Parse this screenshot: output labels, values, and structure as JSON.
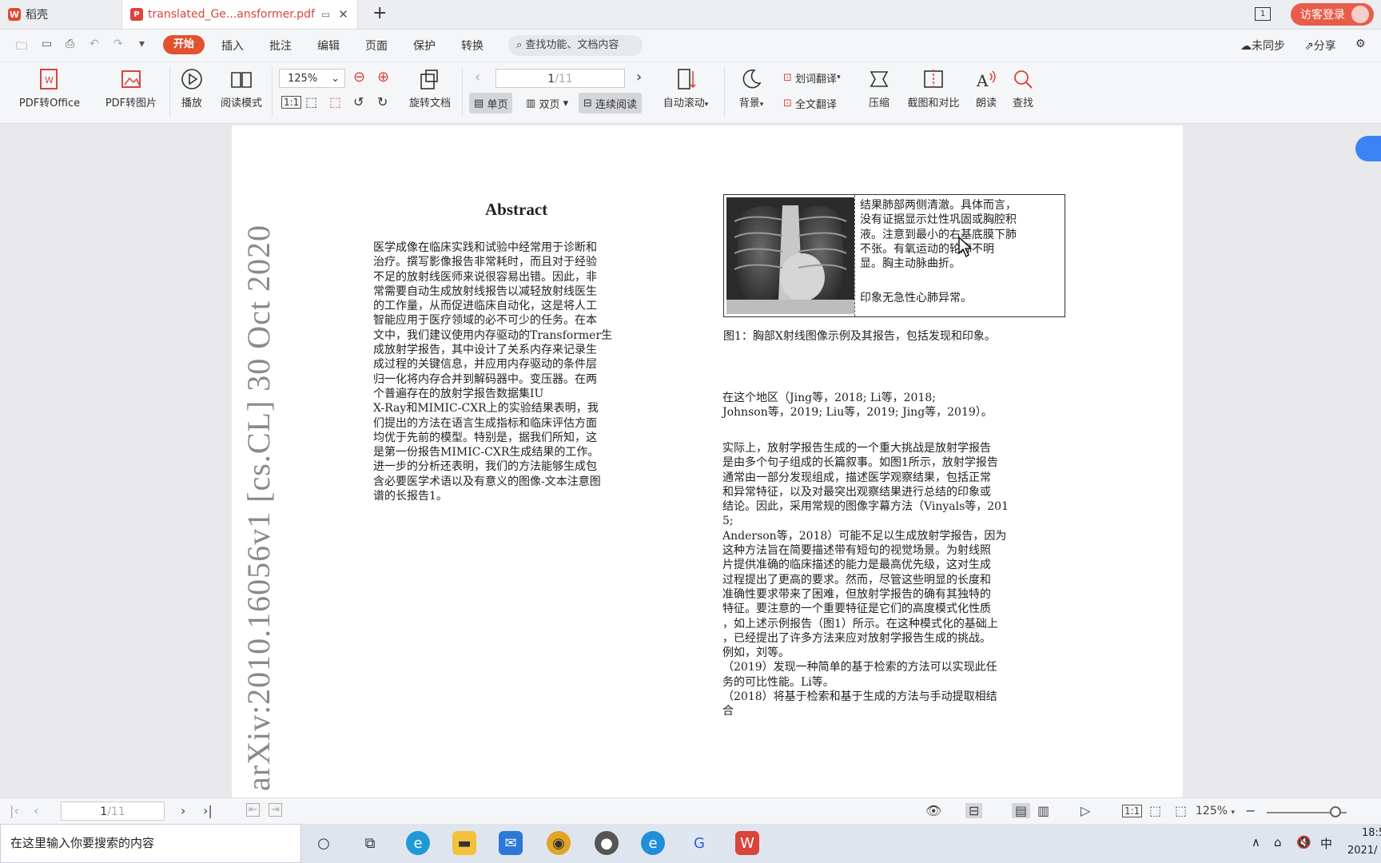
{
  "app": {
    "home_tab": "稻壳",
    "doc_tab": "translated_Ge...ansformer.pdf",
    "new_tab": "+",
    "page_count_icon": "1",
    "login": "访客登录"
  },
  "menu": {
    "items": [
      "开始",
      "插入",
      "批注",
      "编辑",
      "页面",
      "保护",
      "转换"
    ],
    "search_placeholder": "查找功能、文档内容",
    "sync": "未同步",
    "share": "分享"
  },
  "ribbon": {
    "pdf_to_office": "PDF转Office",
    "pdf_to_image": "PDF转图片",
    "play": "播放",
    "read_mode": "阅读模式",
    "zoom": "125%",
    "rotate": "旋转文档",
    "page_current": "1",
    "page_total": "/11",
    "single": "单页",
    "double": "双页",
    "continuous": "连续阅读",
    "auto_scroll": "自动滚动",
    "background": "背景",
    "word_translate": "划词翻译",
    "full_translate": "全文翻译",
    "compress": "压缩",
    "screenshot_compare": "截图和对比",
    "read_aloud": "朗读",
    "find": "查找"
  },
  "document": {
    "arxiv_id": "arXiv:2010.16056v1  [cs.CL]  30 Oct 2020",
    "abstract_title": "Abstract",
    "abstract_body": "医学成像在临床实践和试验中经常用于诊断和\n治疗。撰写影像报告非常耗时，而且对于经验\n不足的放射线医师来说很容易出错。因此，非\n常需要自动生成放射线报告以减轻放射线医生\n的工作量，从而促进临床自动化，这是将人工\n智能应用于医疗领域的必不可少的任务。在本\n文中，我们建议使用内存驱动的Transformer生\n成放射学报告，其中设计了关系内存来记录生\n成过程的关键信息，并应用内存驱动的条件层\n归一化将内存合并到解码器中。变压器。在两\n个普遍存在的放射学报告数据集IU\nX-Ray和MIMIC-CXR上的实验结果表明，我\n们提出的方法在语言生成指标和临床评估方面\n均优于先前的模型。特别是，据我们所知，这\n是第一份报告MIMIC-CXR生成结果的工作。\n进一步的分析还表明，我们的方法能够生成包\n含必要医学术语以及有意义的图像-文本注意图\n谱的长报告1。",
    "figure_findings": "结果肺部两侧清澈。具体而言，\n没有证据显示灶性巩固或胸腔积\n液。注意到最小的右基底膜下肺\n不张。有氧运动的轮廓不明\n显。胸主动脉曲折。",
    "figure_impression": "印象无急性心肺异常。",
    "figure_caption": "图1：胸部X射线图像示例及其报告，包括发现和印象。",
    "para1": "在这个地区（Jing等，2018; Li等，2018;\nJohnson等，2019; Liu等，2019; Jing等，2019）。",
    "para2": "实际上，放射学报告生成的一个重大挑战是放射学报告\n是由多个句子组成的长篇叙事。如图1所示，放射学报告\n通常由一部分发现组成，描述医学观察结果，包括正常\n和异常特征，以及对最突出观察结果进行总结的印象或\n结论。因此，采用常规的图像字幕方法（Vinyals等，201\n5;\nAnderson等，2018）可能不足以生成放射学报告，因为\n这种方法旨在简要描述带有短句的视觉场景。为射线照\n片提供准确的临床描述的能力是最高优先级，这对生成\n过程提出了更高的要求。然而，尽管这些明显的长度和\n准确性要求带来了困难，但放射学报告的确有其独特的\n特征。要注意的一个重要特征是它们的高度模式化性质\n，如上述示例报告（图1）所示。在这种模式化的基础上\n，已经提出了许多方法来应对放射学报告生成的挑战。\n例如，刘等。\n（2019）发现一种简单的基于检索的方法可以实现此任\n务的可比性能。Li等。\n（2018）将基于检索和基于生成的方法与手动提取相结\n合"
  },
  "status": {
    "page_current": "1",
    "page_total": "/11",
    "zoom": "125%"
  },
  "taskbar": {
    "search_placeholder": "在这里输入你要搜索的内容",
    "ime": "中",
    "time": "18:5",
    "date": "2021/"
  },
  "colors": {
    "accent": "#e3512f",
    "brand_blue": "#3b82f6"
  }
}
